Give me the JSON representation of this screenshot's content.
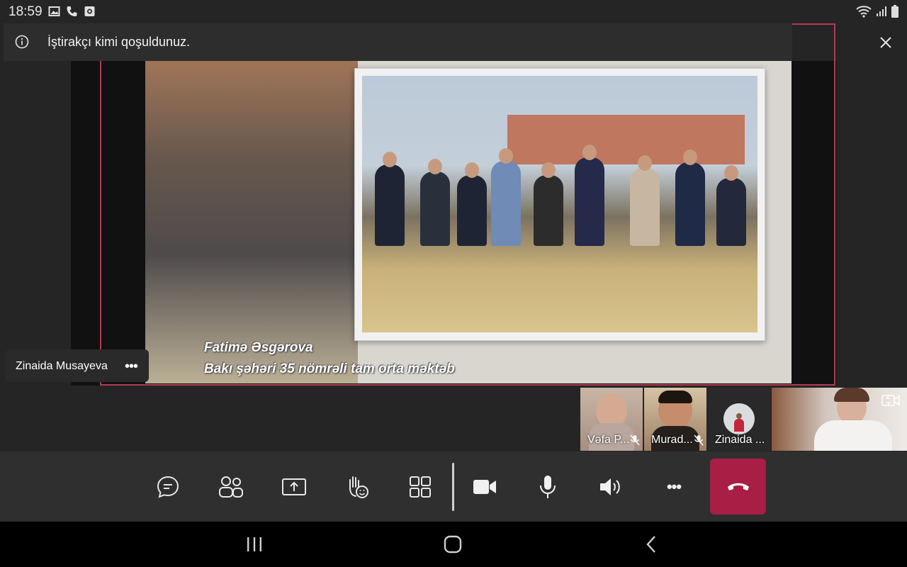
{
  "status_bar": {
    "time": "18:59",
    "left_icons": [
      "image-icon",
      "phone-icon",
      "screen-record-icon"
    ],
    "right_icons": [
      "wifi-icon",
      "signal-icon",
      "battery-icon"
    ]
  },
  "banner": {
    "text": "İştirakçı kimi qoşuldunuz.",
    "info_icon": "info-icon",
    "close_icon": "close-icon"
  },
  "slide": {
    "caption_line1": "Fatimə Əsgərova",
    "caption_line2": "Bakı şəhəri 35 nömrəli tam orta məktəb"
  },
  "presenter": {
    "name": "Zinaida Musayeva",
    "more": "•••"
  },
  "participants": [
    {
      "label": "Vəfa P...",
      "muted": true
    },
    {
      "label": "Murad...",
      "muted": true
    },
    {
      "label": "Zinaida ...",
      "muted": false
    },
    {
      "label": "",
      "self_view": true
    }
  ],
  "controls": {
    "items": [
      "chat-icon",
      "participants-icon",
      "share-icon",
      "raise-hand-icon",
      "gallery-icon",
      "camera-icon",
      "microphone-icon",
      "speaker-icon",
      "more-icon",
      "hangup-icon"
    ],
    "more_label": "•••"
  },
  "colors": {
    "accent": "#b13a54",
    "hangup": "#a81e44",
    "background": "#252525",
    "controls_bg": "#2f2f2f"
  }
}
